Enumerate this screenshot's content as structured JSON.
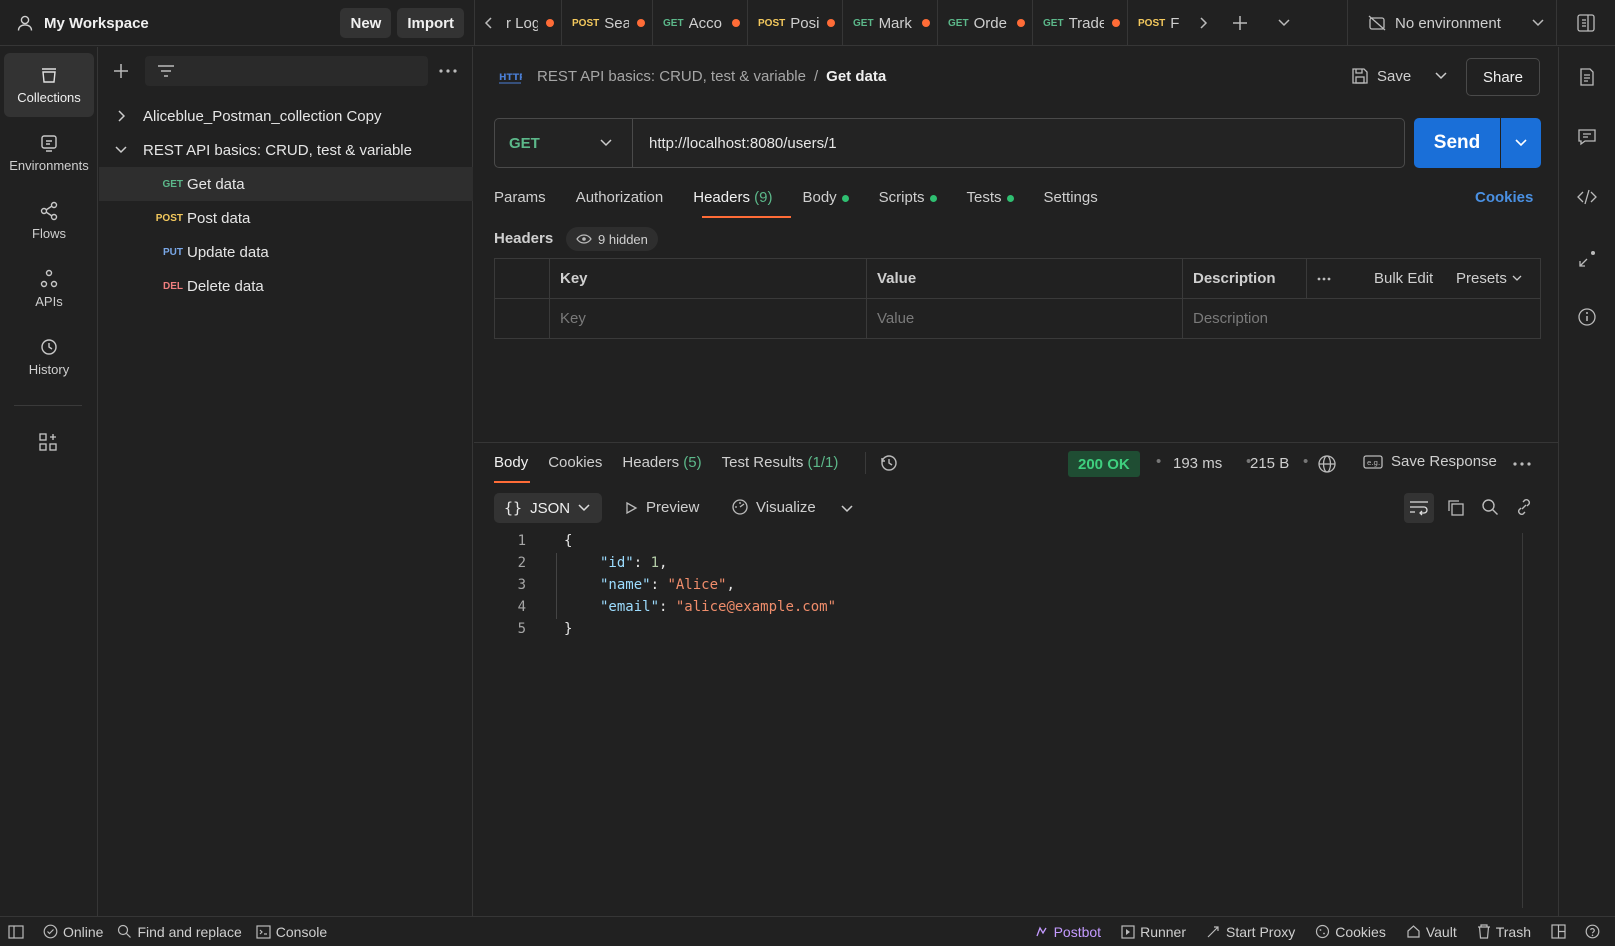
{
  "workspace": {
    "title": "My Workspace",
    "new_label": "New",
    "import_label": "Import"
  },
  "request_tabs": [
    {
      "method": "",
      "name": "r Log"
    },
    {
      "method": "POST",
      "name": "Sea"
    },
    {
      "method": "GET",
      "name": "Acco"
    },
    {
      "method": "POST",
      "name": "Posi"
    },
    {
      "method": "GET",
      "name": "Mark"
    },
    {
      "method": "GET",
      "name": "Orde"
    },
    {
      "method": "GET",
      "name": "Trade"
    },
    {
      "method": "POST",
      "name": "F"
    }
  ],
  "environment": {
    "label": "No environment"
  },
  "rail": [
    {
      "label": "Collections",
      "icon": "trash-bin-icon"
    },
    {
      "label": "Environments",
      "icon": "environment-icon"
    },
    {
      "label": "Flows",
      "icon": "flows-icon"
    },
    {
      "label": "APIs",
      "icon": "apis-icon"
    },
    {
      "label": "History",
      "icon": "history-icon"
    }
  ],
  "sidebar": {
    "collections": [
      {
        "name": "Aliceblue_Postman_collection Copy",
        "expanded": false
      },
      {
        "name": "REST API basics: CRUD, test & variable",
        "expanded": true
      }
    ],
    "requests": [
      {
        "method": "GET",
        "name": "Get data"
      },
      {
        "method": "POST",
        "name": "Post data"
      },
      {
        "method": "PUT",
        "name": "Update data"
      },
      {
        "method": "DEL",
        "name": "Delete data"
      }
    ]
  },
  "request": {
    "breadcrumb_parent": "REST API basics: CRUD, test & variable",
    "breadcrumb_sep": "/",
    "title": "Get data",
    "save_label": "Save",
    "share_label": "Share",
    "method": "GET",
    "url": "http://localhost:8080/users/1",
    "send_label": "Send",
    "tabs": {
      "params": "Params",
      "authorization": "Authorization",
      "headers": "Headers",
      "headers_count": "(9)",
      "body": "Body",
      "scripts": "Scripts",
      "tests": "Tests",
      "settings": "Settings"
    },
    "cookies_label": "Cookies",
    "headers_title": "Headers",
    "hidden_label": "9 hidden",
    "table": {
      "col_key": "Key",
      "col_value": "Value",
      "col_description": "Description",
      "bulk_edit": "Bulk Edit",
      "presets": "Presets",
      "placeholder_key": "Key",
      "placeholder_value": "Value",
      "placeholder_description": "Description"
    }
  },
  "response": {
    "tabs": {
      "body": "Body",
      "cookies": "Cookies",
      "headers": "Headers",
      "headers_count": "(5)",
      "test_results": "Test Results",
      "test_count": "(1/1)"
    },
    "status": "200 OK",
    "time": "193 ms",
    "size": "215 B",
    "save_response": "Save Response",
    "format": "JSON",
    "preview": "Preview",
    "visualize": "Visualize",
    "lines": [
      "1",
      "2",
      "3",
      "4",
      "5"
    ],
    "code": {
      "open": "{",
      "k1": "\"id\"",
      "v1": "1",
      "k2": "\"name\"",
      "v2": "\"Alice\"",
      "k3": "\"email\"",
      "v3": "\"alice@example.com\"",
      "close": "}"
    }
  },
  "statusbar": {
    "online": "Online",
    "find_replace": "Find and replace",
    "console": "Console",
    "postbot": "Postbot",
    "runner": "Runner",
    "start_proxy": "Start Proxy",
    "cookies": "Cookies",
    "vault": "Vault",
    "trash": "Trash"
  },
  "colors": {
    "accent": "#1a6fd8",
    "postbot": "#c49bff",
    "ok_bg": "#1f4d33",
    "ok_text": "#3fd07f"
  }
}
